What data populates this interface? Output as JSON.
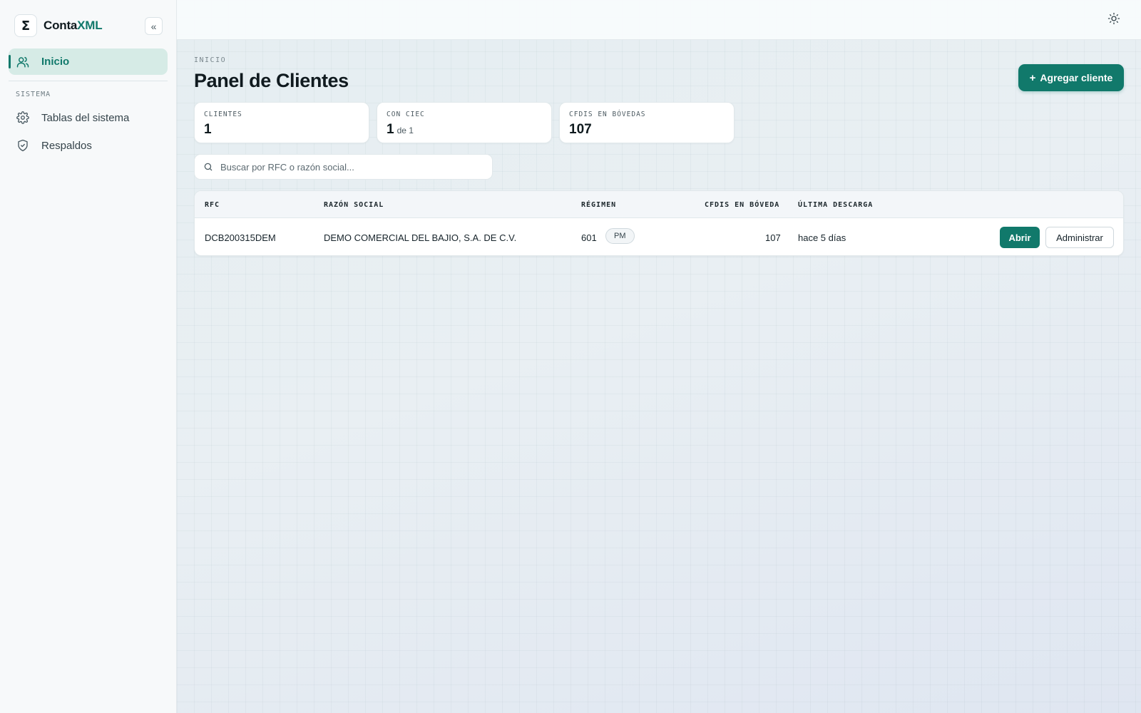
{
  "brand": {
    "logo_glyph": "Σ",
    "name_part1": "Conta",
    "name_part2": "XML",
    "accent_color": "#11796b"
  },
  "sidebar": {
    "collapse_glyph": "«",
    "active_item": {
      "label": "Inicio",
      "icon": "users-icon"
    },
    "section_label": "SISTEMA",
    "items": [
      {
        "label": "Tablas del sistema",
        "icon": "gear-icon"
      },
      {
        "label": "Respaldos",
        "icon": "shield-check-icon"
      }
    ]
  },
  "topbar": {
    "theme_icon": "sun-icon"
  },
  "header": {
    "eyebrow": "INICIO",
    "title": "Panel de Clientes",
    "add_button_icon": "+",
    "add_button": "Agregar cliente"
  },
  "stats": [
    {
      "label": "CLIENTES",
      "value": "1",
      "suffix": ""
    },
    {
      "label": "CON CIEC",
      "value": "1",
      "suffix": "de 1"
    },
    {
      "label": "CFDIS EN BÓVEDAS",
      "value": "107",
      "suffix": ""
    }
  ],
  "search": {
    "placeholder": "Buscar por RFC o razón social...",
    "value": "",
    "icon": "search-icon"
  },
  "table": {
    "columns": [
      "RFC",
      "RAZÓN SOCIAL",
      "RÉGIMEN",
      "CFDIS EN BÓVEDA",
      "ÚLTIMA DESCARGA"
    ],
    "rows": [
      {
        "rfc": "DCB200315DEM",
        "razon_social": "DEMO COMERCIAL DEL BAJIO, S.A. DE C.V.",
        "regimen": "601",
        "regimen_badge": "PM",
        "cfdis": "107",
        "ultima_descarga": "hace 5 días",
        "open_label": "Abrir",
        "manage_label": "Administrar"
      }
    ]
  }
}
